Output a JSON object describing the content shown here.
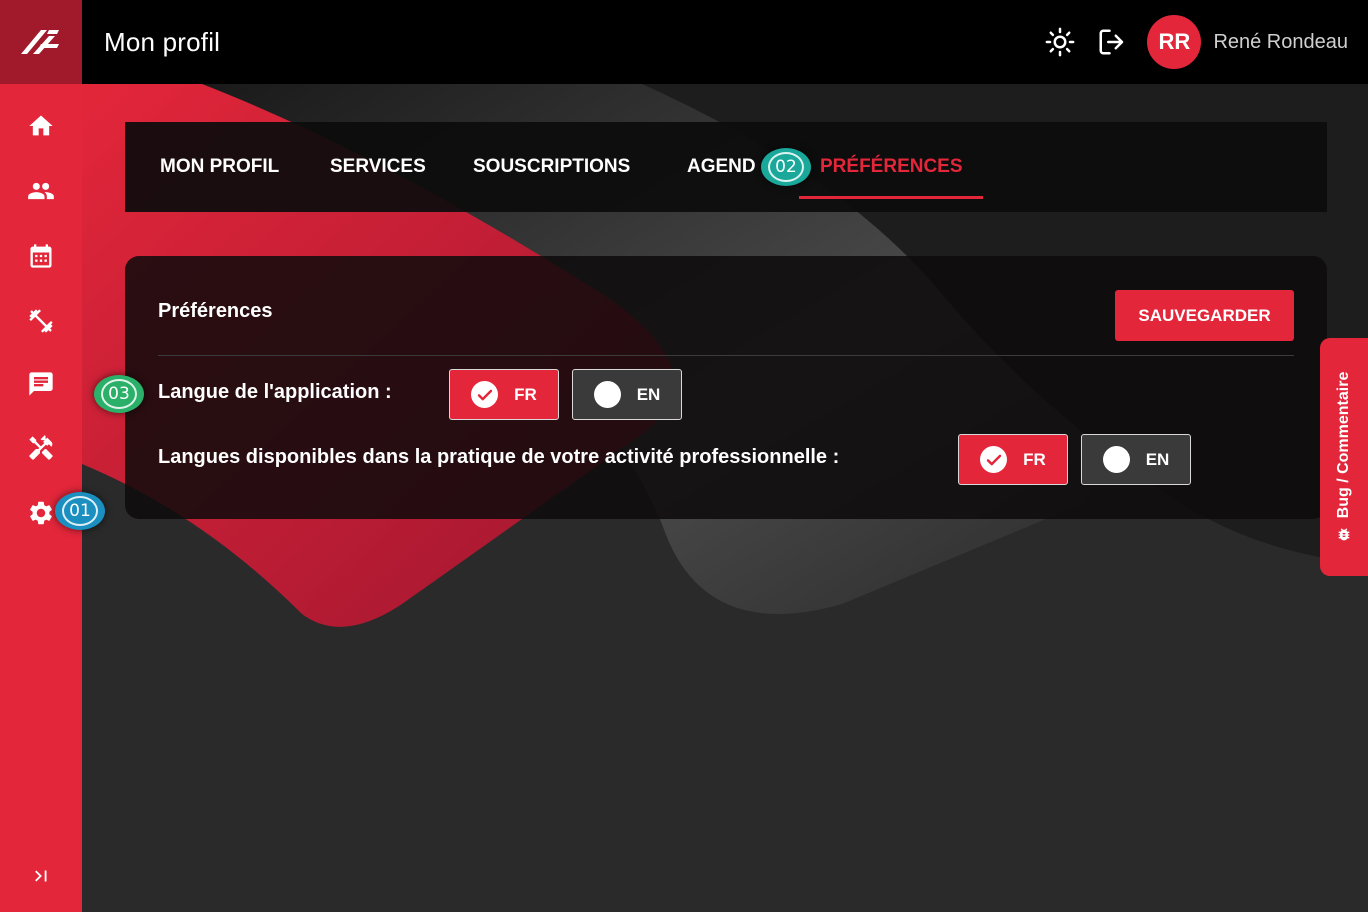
{
  "header": {
    "title": "Mon profil",
    "user_initials": "RR",
    "user_name": "René Rondeau"
  },
  "tabs": [
    {
      "label": "MON PROFIL"
    },
    {
      "label": "SERVICES"
    },
    {
      "label": "SOUSCRIPTIONS"
    },
    {
      "label": "AGEND"
    },
    {
      "label": "PRÉFÉRENCES",
      "active": true
    }
  ],
  "preferences": {
    "title": "Préférences",
    "save_label": "SAUVEGARDER",
    "app_language_label": "Langue de l'application :",
    "available_languages_label": "Langues disponibles dans la pratique de votre activité professionnelle :",
    "app_language_options": [
      {
        "label": "FR",
        "selected": true
      },
      {
        "label": "EN",
        "selected": false
      }
    ],
    "available_language_options": [
      {
        "label": "FR",
        "selected": true
      },
      {
        "label": "EN",
        "selected": false
      }
    ]
  },
  "markers": {
    "m1": "01",
    "m2": "02",
    "m3": "03"
  },
  "bug_tab": {
    "label": "Bug / Commentaire"
  },
  "icons": {
    "sidebar": [
      "home-icon",
      "users-icon",
      "calendar-icon",
      "dumbbell-icon",
      "chat-icon",
      "tools-icon",
      "gear-icon",
      "expand-icon"
    ],
    "top": [
      "sun-icon",
      "logout-icon"
    ]
  },
  "colors": {
    "accent": "#e3263a",
    "sidebar_logo_bg": "#a01a2b",
    "topbar": "#000000",
    "background": "#2a2a2b",
    "marker_blue": "#1b8fc0",
    "marker_teal": "#1aa89a",
    "marker_green": "#2bb06a"
  }
}
